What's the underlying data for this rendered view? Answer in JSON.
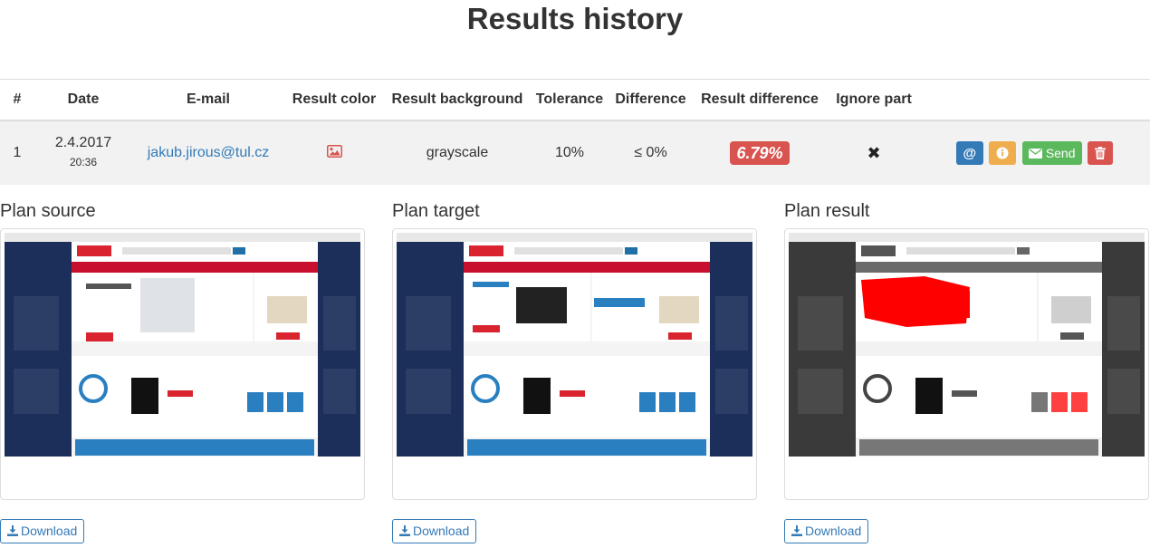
{
  "page": {
    "title": "Results history"
  },
  "table": {
    "headers": [
      "#",
      "Date",
      "E-mail",
      "Result color",
      "Result background",
      "Tolerance",
      "Difference",
      "Result difference",
      "Ignore part",
      ""
    ],
    "rows": [
      {
        "index": "1",
        "date": "2.4.2017",
        "time": "20:36",
        "email": "jakub.jirous@tul.cz",
        "result_color_icon": "image-icon",
        "result_background": "grayscale",
        "tolerance": "10%",
        "difference": "≤ 0%",
        "result_difference": "6.79%",
        "ignore_part": "✖",
        "actions": {
          "email_icon": "at-icon",
          "info_icon": "info-icon",
          "send_label": "Send",
          "delete_icon": "trash-icon"
        }
      }
    ]
  },
  "plans": [
    {
      "title": "Plan source",
      "download_label": "Download"
    },
    {
      "title": "Plan target",
      "download_label": "Download"
    },
    {
      "title": "Plan result",
      "download_label": "Download"
    }
  ],
  "colors": {
    "link": "#337ab7",
    "danger": "#d9534f",
    "success": "#5cb85c",
    "warning": "#f0ad4e",
    "row_bg": "#f2f2f2"
  }
}
